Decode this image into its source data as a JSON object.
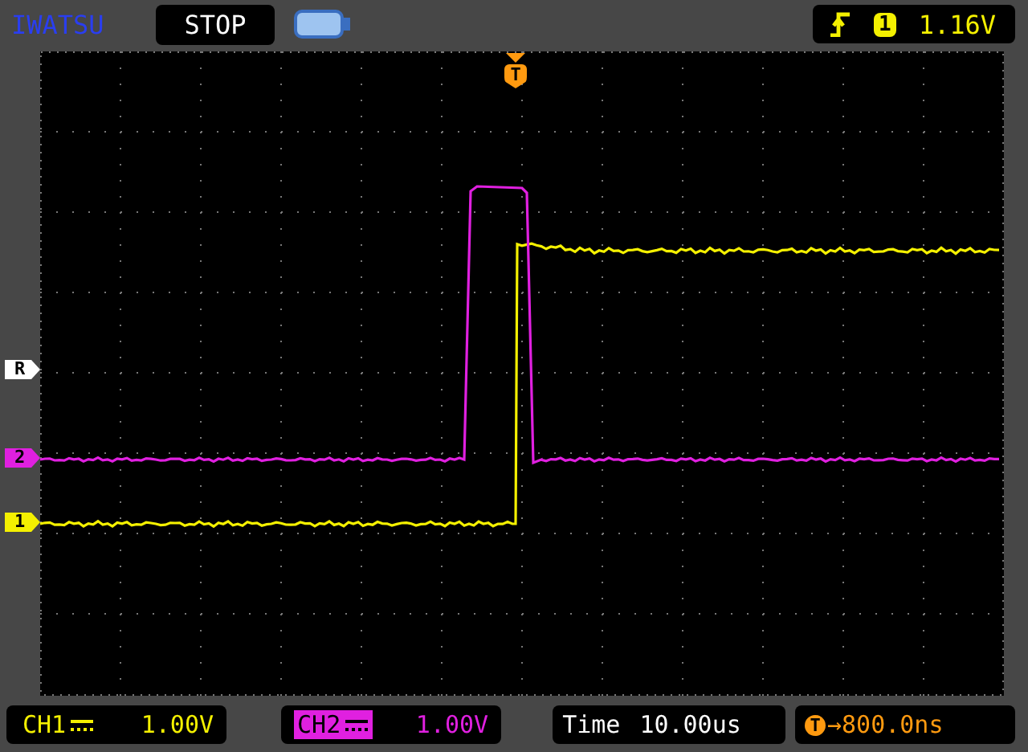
{
  "header": {
    "brand": "IWATSU",
    "run_state": "STOP",
    "trigger_source": "1",
    "trigger_level": "1.16V"
  },
  "trigger_marker": {
    "label": "T"
  },
  "level_markers": [
    {
      "label": "R",
      "color": "#ffffff"
    },
    {
      "label": "2",
      "color": "#e020e0"
    },
    {
      "label": "1",
      "color": "#f4f000"
    }
  ],
  "channels": [
    {
      "name": "CH1",
      "color": "#f4f000",
      "scale": "1.00V",
      "selected": false
    },
    {
      "name": "CH2",
      "color": "#e020e0",
      "scale": "1.00V",
      "selected": true
    }
  ],
  "timebase": {
    "label": "Time",
    "value": "10.00us"
  },
  "trigger_delay": {
    "marker": "T",
    "value": "→800.0ns"
  }
}
